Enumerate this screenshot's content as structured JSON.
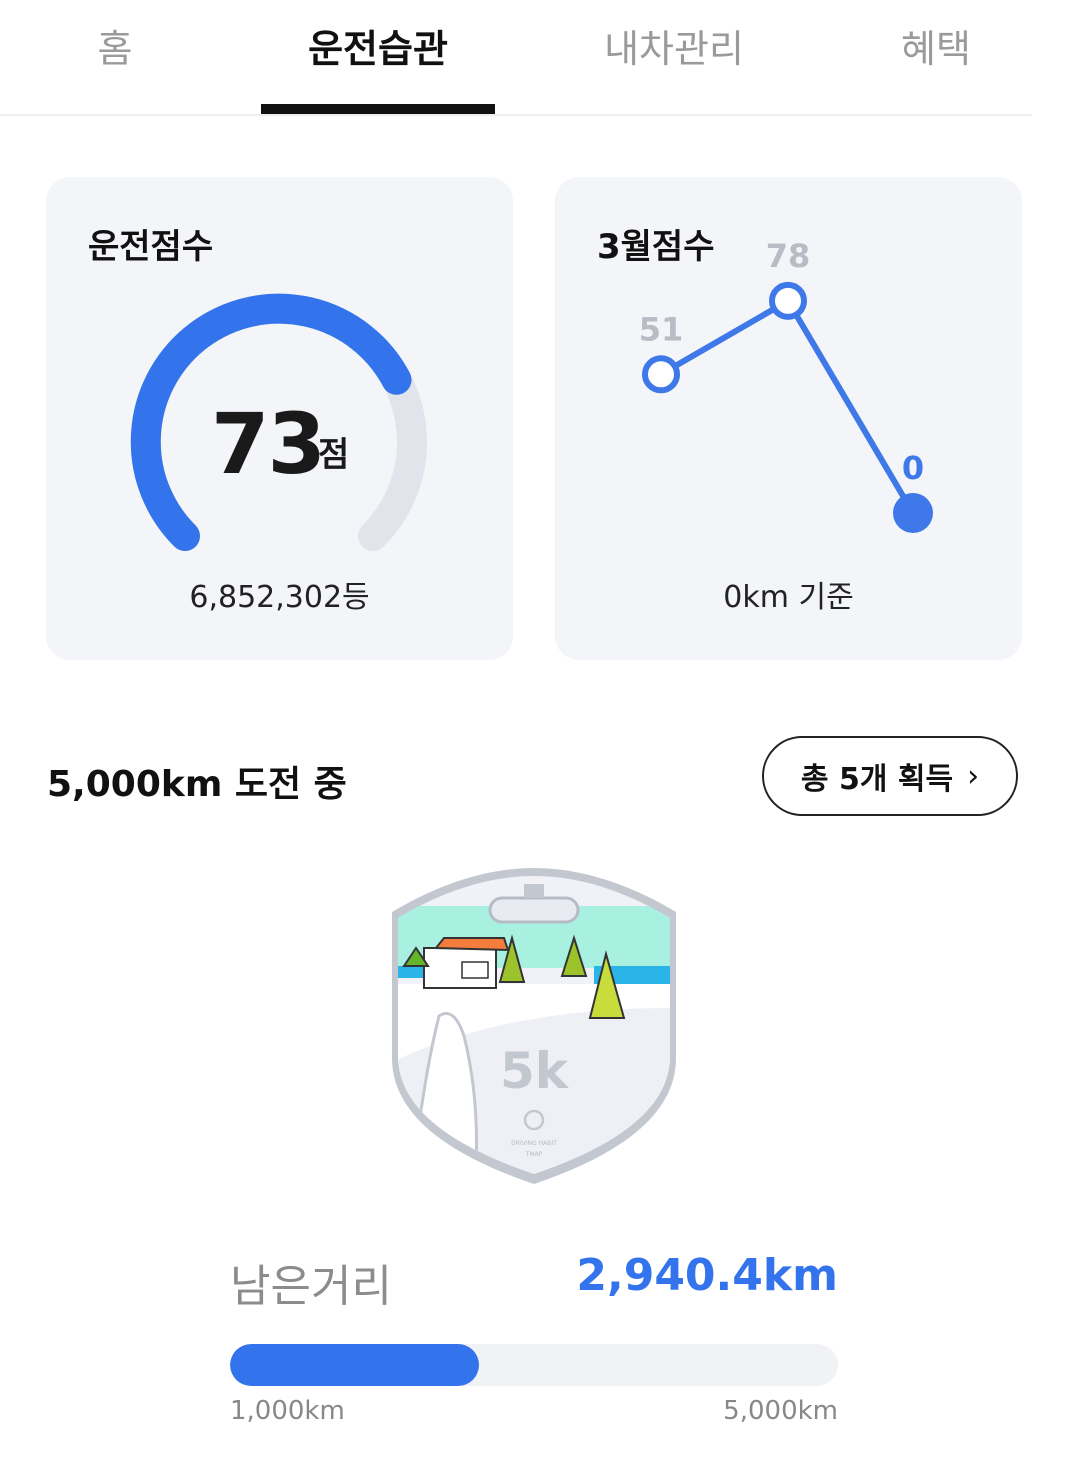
{
  "tabs": [
    {
      "label": "홈",
      "active": false
    },
    {
      "label": "운전습관",
      "active": true
    },
    {
      "label": "내차관리",
      "active": false
    },
    {
      "label": "혜택",
      "active": false
    }
  ],
  "score_card": {
    "title": "운전점수",
    "score": "73",
    "unit": "점",
    "score_max": 100,
    "rank": "6,852,302등"
  },
  "monthly_card": {
    "title": "3월점수",
    "footnote": "0km 기준",
    "chart_data": {
      "type": "line",
      "values": [
        51,
        78,
        0
      ],
      "value_labels": [
        "51",
        "78",
        "0"
      ],
      "highlight_index": 2,
      "colors": {
        "line": "#3f78e8",
        "past_label": "#b9bcc4",
        "current_label": "#3f78e8"
      }
    }
  },
  "challenge": {
    "title": "5,000km 도전 중",
    "badge_button": "총 5개 획득",
    "shield_text": "5k",
    "shield_caption_1": "DRIVING HABIT",
    "shield_caption_2": "TMAP",
    "remaining_label": "남은거리",
    "remaining_value": "2,940.4km",
    "progress_fraction": 0.41,
    "range_min": "1,000km",
    "range_max": "5,000km"
  },
  "colors": {
    "accent": "#3374ec",
    "card_bg": "#f4f5f8",
    "track": "#e1e4ea"
  }
}
